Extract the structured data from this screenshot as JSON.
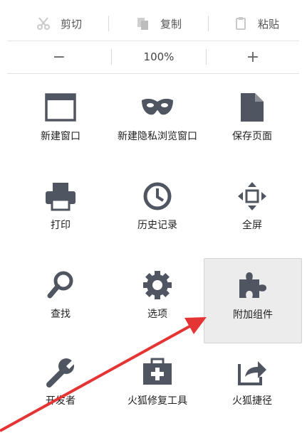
{
  "edit_row": {
    "cut_label": "剪切",
    "copy_label": "复制",
    "paste_label": "粘贴"
  },
  "zoom_row": {
    "minus_label": "−",
    "zoom_value": "100%",
    "plus_label": "+"
  },
  "tiles": {
    "new_window": "新建窗口",
    "private_window": "新建隐私浏览窗口",
    "save_page": "保存页面",
    "print": "打印",
    "history": "历史记录",
    "fullscreen": "全屏",
    "find": "查找",
    "options": "选项",
    "addons": "附加组件",
    "developer": "开发者",
    "repair": "火狐修复工具",
    "shortcut": "火狐捷径"
  },
  "icons": {
    "cut": "scissors-icon",
    "copy": "copy-icon",
    "paste": "clipboard-icon",
    "new_window": "window-icon",
    "private_window": "mask-icon",
    "save_page": "page-icon",
    "print": "printer-icon",
    "history": "clock-icon",
    "fullscreen": "fullscreen-arrows-icon",
    "find": "magnifier-icon",
    "options": "gear-icon",
    "addons": "puzzle-icon",
    "developer": "wrench-icon",
    "repair": "toolbox-icon",
    "shortcut": "share-icon"
  },
  "colors": {
    "icon": "#505661",
    "highlight_bg": "#ececec",
    "arrow": "#e53434"
  }
}
